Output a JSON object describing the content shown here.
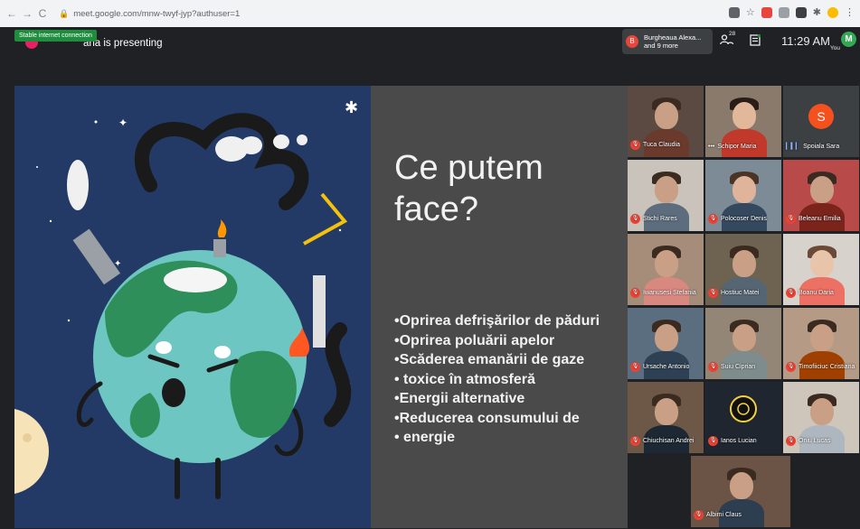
{
  "browser": {
    "back": "←",
    "forward": "→",
    "reload": "C",
    "url": "meet.google.com/mnw-twyf-jyp?authuser=1"
  },
  "meet": {
    "connection_status": "Stable internet connection",
    "presenting_text": "aria is presenting",
    "speaker_initial": "B",
    "speaker_name": "Burgheaua Alexa...",
    "speaker_more": "and 9 more",
    "participants_count": "28",
    "time": "11:29 AM",
    "self_initial": "M",
    "self_label": "You"
  },
  "slide": {
    "title_line1": "Ce putem",
    "title_line2": "face?",
    "bullets": [
      "Oprirea defrişărilor de păduri",
      "Oprirea poluării apelor",
      "Scăderea emanării de gaze",
      " toxice în atmosferă",
      "Energii alternative",
      "Reducerea consumului de",
      " energie"
    ]
  },
  "participants": [
    {
      "name": "Tuca Claudia"
    },
    {
      "name": "Schipor Maria"
    },
    {
      "name": "Spoiala Sara",
      "initial": "S"
    },
    {
      "name": "Stichi Rares"
    },
    {
      "name": "Polocoser Denis"
    },
    {
      "name": "Beleanu Emilia"
    },
    {
      "name": "Iwanusesi Stefania"
    },
    {
      "name": "Hostiuc Matei"
    },
    {
      "name": "Boanu Daria"
    },
    {
      "name": "Ursache Antonio"
    },
    {
      "name": "Suiu Ciprian"
    },
    {
      "name": "Timofiiciuc Cristiana"
    },
    {
      "name": "Chiuchisan Andrei"
    },
    {
      "name": "Ianos Lucian"
    },
    {
      "name": "Oniu Lucas"
    },
    {
      "name": "Albimi Claus"
    }
  ],
  "colors": {
    "meet_bg": "#202124",
    "slide_text_bg": "#4a4a4a",
    "slide_art_bg": "#243a66",
    "mute_red": "#ea4335",
    "connection_green": "#1e8e3e"
  }
}
